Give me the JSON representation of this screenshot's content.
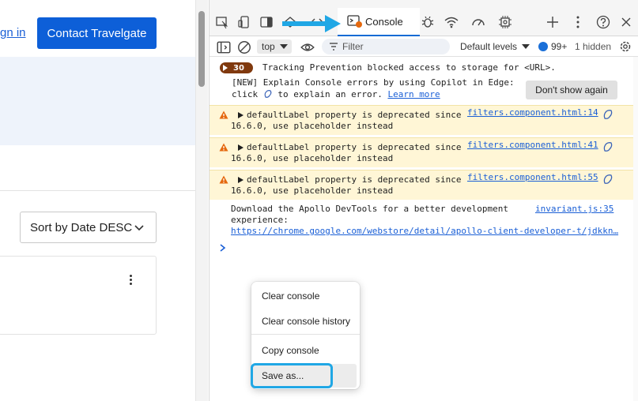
{
  "page": {
    "signin_label": "gn in",
    "contact_button": "Contact Travelgate",
    "sort_label": "Sort by Date DESC"
  },
  "devtools": {
    "active_tab": "Console",
    "toolbar": {
      "context": "top",
      "filter_placeholder": "Filter",
      "levels": "Default levels",
      "issues_count": "99+",
      "hidden_count": "1 hidden"
    },
    "messages": {
      "tracking_count": "30",
      "tracking_text": "Tracking Prevention blocked access to storage for <URL>.",
      "copilot_line1": "[NEW] Explain Console errors by using Copilot in Edge:",
      "copilot_line2_a": "click",
      "copilot_line2_b": "to explain an error.",
      "copilot_link": "Learn more",
      "dont_show_button": "Don't show again",
      "warnings": [
        {
          "line1": "defaultLabel property is deprecated since",
          "line2": "16.6.0, use placeholder instead",
          "source": "filters.component.html:14"
        },
        {
          "line1": "defaultLabel property is deprecated since",
          "line2": "16.6.0, use placeholder instead",
          "source": "filters.component.html:41"
        },
        {
          "line1": "defaultLabel property is deprecated since",
          "line2": "16.6.0, use placeholder instead",
          "source": "filters.component.html:55"
        }
      ],
      "apollo_line1": "Download the Apollo DevTools for a better development",
      "apollo_line2": "experience:",
      "apollo_url": "https://chrome.google.com/webstore/detail/apollo-client-developer-t/jdkkn…",
      "apollo_source": "invariant.js:35"
    },
    "context_menu": {
      "items": [
        "Clear console",
        "Clear console history",
        "Copy console",
        "Save as..."
      ],
      "highlighted_item": "Save as..."
    },
    "colors": {
      "accent": "#0e6ad4",
      "warning_bg": "#fff6d6",
      "highlight": "#20a7e5",
      "contact_button": "#0d5fd8"
    }
  }
}
